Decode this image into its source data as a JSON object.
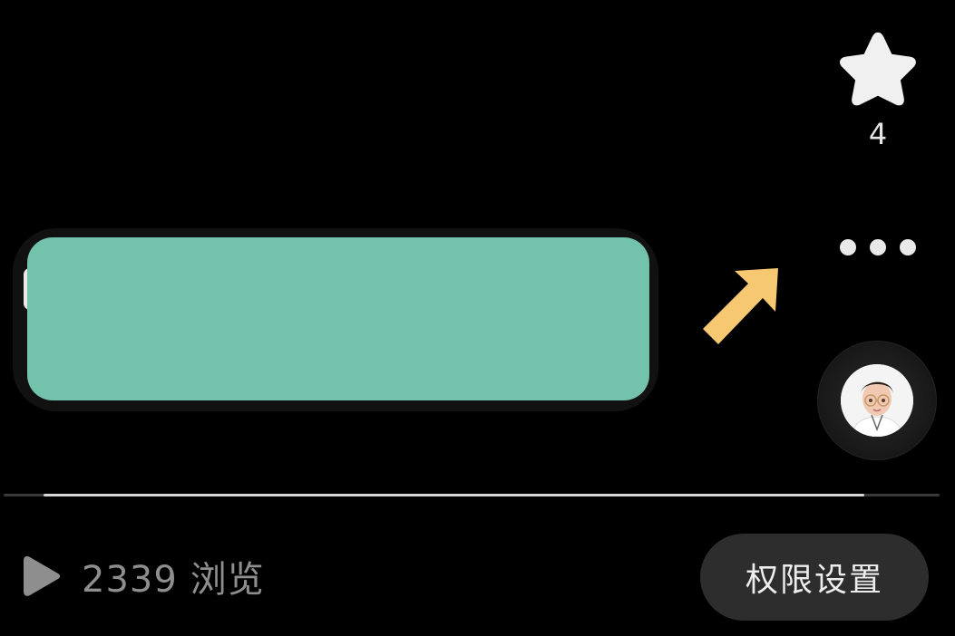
{
  "favorite": {
    "icon": "star-icon",
    "count": "4",
    "color": "#f0f0f0"
  },
  "more": {
    "icon": "more-dots-icon"
  },
  "annotation": {
    "icon": "arrow-up-right-icon",
    "color": "#f6c872"
  },
  "redaction": {
    "color": "#73c2ab"
  },
  "profile": {
    "icon": "avatar-icon"
  },
  "playback": {
    "progress_fraction": 0.92
  },
  "stats": {
    "play_icon": "play-icon",
    "views_count": "2339",
    "views_label": "浏览"
  },
  "actions": {
    "permission_label": "权限设置",
    "button_color": "#2d2d2d"
  }
}
